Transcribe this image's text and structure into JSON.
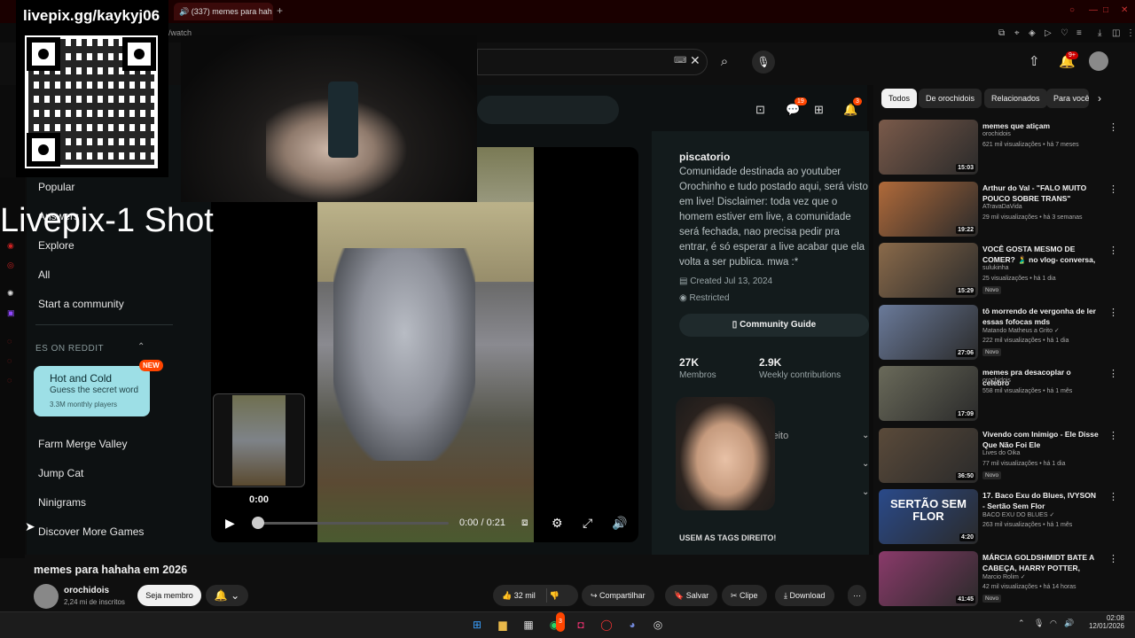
{
  "browser": {
    "tab_title": "(337) memes para hah",
    "tab_plus": "+",
    "url": "/watch"
  },
  "overlay": {
    "stream_handle": "livepix.gg/kaykyj06",
    "shot_label": "Livepix-1 Shot"
  },
  "search": {
    "kbd_icon": "keyboard-icon",
    "clear": "✕"
  },
  "header_badges": {
    "notifications": "9+"
  },
  "reddit": {
    "badges": {
      "chat": "19",
      "inbox": "3"
    },
    "nav": {
      "popular": "Popular",
      "answers": "Answers",
      "explore": "Explore",
      "all": "All",
      "start_community": "Start a community",
      "section": "ES ON REDDIT"
    },
    "game_card": {
      "title": "Hot and Cold",
      "subtitle": "Guess the secret word",
      "players": "3.3M monthly players",
      "badge": "NEW"
    },
    "games": [
      "Farm Merge Valley",
      "Jump Cat",
      "Ninigrams",
      "Discover More Games"
    ],
    "community": {
      "name": "piscatorio",
      "description": "Comunidade destinada ao youtuber Orochinho e tudo postado aqui, será visto em live! Disclaimer: toda vez que o homem estiver em live, a comunidade será fechada, nao precisa pedir pra entrar, é só esperar a live acabar que ela volta a ser publica. mwa :*",
      "created": "Created Jul 13, 2024",
      "restricted": "Restricted",
      "guide_button": "Community Guide",
      "members_num": "27K",
      "members_label": "Membros",
      "contrib_num": "2.9K",
      "contrib_label": "Weekly contributions",
      "partial_text": "ceito",
      "tags_text": "USEM AS TAGS DIREITO!"
    },
    "player": {
      "preview_time": "0:00",
      "time": "0:00 / 0:21",
      "progress": 0.0
    }
  },
  "video": {
    "title": "memes para hahaha em 2026",
    "channel": "orochidois",
    "subs": "2,24 mi de inscritos",
    "join": "Seja membro",
    "likes": "32 mil",
    "share": "Compartilhar",
    "save": "Salvar",
    "clip": "Clipe",
    "download": "Download"
  },
  "chips": [
    "Todos",
    "De orochidois",
    "Relacionados",
    "Para você"
  ],
  "recs": [
    {
      "title": "memes que atiçam",
      "channel": "orochidois",
      "views": "621 mil visualizações • há 7 meses",
      "duration": "15:03",
      "new": "",
      "color": "#7a5a4a"
    },
    {
      "title": "Arthur do Val - \"FALO MUITO POUCO SOBRE TRANS\"",
      "channel": "ATravaDaVida",
      "views": "29 mil visualizações • há 3 semanas",
      "duration": "19:22",
      "new": "",
      "color": "#b06a3a"
    },
    {
      "title": "VOCÊ GOSTA MESMO DE COMER? 🫃 no vlog- conversa, vamos falar...",
      "channel": "sulukinha",
      "views": "25 visualizações • há 1 dia",
      "duration": "15:29",
      "new": "Novo",
      "color": "#8a6a4a"
    },
    {
      "title": "tô morrendo de vergonha de ler essas fofocas mds",
      "channel": "Matando Matheus a Grito ✓",
      "views": "222 mil visualizações • há 1 dia",
      "duration": "27:06",
      "new": "Novo",
      "color": "#6a7a9a"
    },
    {
      "title": "memes pra desacoplar o celebro",
      "channel": "orochidois",
      "views": "558 mil visualizações • há 1 mês",
      "duration": "17:09",
      "new": "",
      "color": "#6a6a5a"
    },
    {
      "title": "Vivendo com Inimigo - Ele Disse Que Não Foi Ele",
      "channel": "Lives do Oika",
      "views": "77 mil visualizações • há 1 dia",
      "duration": "36:50",
      "new": "Novo",
      "color": "#5a4a3a"
    },
    {
      "title": "17. Baco Exu do Blues, IVYSON - Sertão Sem Flor",
      "channel": "BACO EXU DO BLUES ✓",
      "views": "263 mil visualizações • há 1 mês",
      "duration": "4:20",
      "new": "",
      "color": "#2a4a8a",
      "thumb_text": "SERTÃO SEM FLOR"
    },
    {
      "title": "MÁRCIA GOLDSHMIDT BATE A CABEÇA, HARRY POTTER, FÁBIO ...",
      "channel": "Marcio Rolim ✓",
      "views": "42 mil visualizações • há 14 horas",
      "duration": "41:45",
      "new": "Novo",
      "color": "#8a3a6a"
    }
  ],
  "taskbar": {
    "time": "02:08",
    "date": "12/01/2026",
    "whatsapp_badge": "3"
  }
}
